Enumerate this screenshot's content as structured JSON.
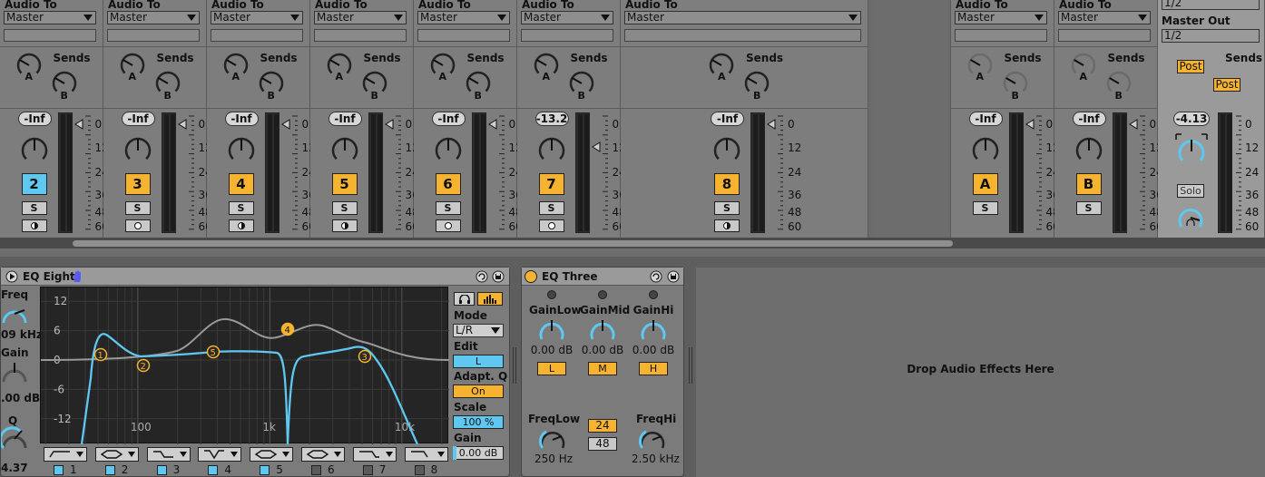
{
  "mixer": {
    "tracks": [
      {
        "audio_to_label": "Audio To",
        "output": "Master",
        "sends_label": "Sends",
        "send_a": "A",
        "send_b": "B",
        "volume": "-Inf",
        "number": "2",
        "number_color": "#5ec8f0",
        "solo": "S",
        "rec_style": "half"
      },
      {
        "audio_to_label": "Audio To",
        "output": "Master",
        "sends_label": "Sends",
        "send_a": "A",
        "send_b": "B",
        "volume": "-Inf",
        "number": "3",
        "number_color": "#f5b330",
        "solo": "S",
        "rec_style": "ring"
      },
      {
        "audio_to_label": "Audio To",
        "output": "Master",
        "sends_label": "Sends",
        "send_a": "A",
        "send_b": "B",
        "volume": "-Inf",
        "number": "4",
        "number_color": "#f5b330",
        "solo": "S",
        "rec_style": "half"
      },
      {
        "audio_to_label": "Audio To",
        "output": "Master",
        "sends_label": "Sends",
        "send_a": "A",
        "send_b": "B",
        "volume": "-Inf",
        "number": "5",
        "number_color": "#f5b330",
        "solo": "S",
        "rec_style": "half"
      },
      {
        "audio_to_label": "Audio To",
        "output": "Master",
        "sends_label": "Sends",
        "send_a": "A",
        "send_b": "B",
        "volume": "-Inf",
        "number": "6",
        "number_color": "#f5b330",
        "solo": "S",
        "rec_style": "ring"
      },
      {
        "audio_to_label": "Audio To",
        "output": "Master",
        "sends_label": "Sends",
        "send_a": "A",
        "send_b": "B",
        "volume": "-13.2",
        "number": "7",
        "number_color": "#f5b330",
        "solo": "S",
        "rec_style": "ring"
      },
      {
        "audio_to_label": "Audio To",
        "output": "Master",
        "sends_label": "Sends",
        "send_a": "A",
        "send_b": "B",
        "volume": "-Inf",
        "number": "8",
        "number_color": "#f5b330",
        "solo": "S",
        "rec_style": "half"
      }
    ],
    "returns": [
      {
        "audio_to_label": "Audio To",
        "output": "Master",
        "sends_label": "Sends",
        "send_a": "A",
        "send_b": "B",
        "volume": "-Inf",
        "number": "A",
        "number_color": "#f5b330",
        "solo": "S"
      },
      {
        "audio_to_label": "Audio To",
        "output": "Master",
        "sends_label": "Sends",
        "send_a": "A",
        "send_b": "B",
        "volume": "-Inf",
        "number": "B",
        "number_color": "#f5b330",
        "solo": "S"
      }
    ],
    "master": {
      "top_value": "1/2",
      "out_label": "Master Out",
      "out_value": "1/2",
      "sends_label": "Sends",
      "post_a": "Post",
      "post_b": "Post",
      "volume": "-4.13",
      "solo": "Solo"
    },
    "meter_scale": [
      "0",
      "12",
      "24",
      "36",
      "48",
      "60"
    ]
  },
  "eq_eight": {
    "title": "EQ Eight",
    "freq_label": "Freq",
    "freq_value": "09 kHz",
    "gain_label": "Gain",
    "gain_value": ".00 dB",
    "q_label": "Q",
    "q_value": "4.37",
    "y_ticks": [
      "12",
      "6",
      "0",
      "-6",
      "-12"
    ],
    "x_ticks": [
      "100",
      "1k",
      "10k"
    ],
    "band_markers": [
      "1",
      "2",
      "5",
      "4",
      "3"
    ],
    "bands": [
      {
        "num": "1",
        "on": true
      },
      {
        "num": "2",
        "on": true
      },
      {
        "num": "3",
        "on": true
      },
      {
        "num": "4",
        "on": true
      },
      {
        "num": "5",
        "on": true
      },
      {
        "num": "6",
        "on": false
      },
      {
        "num": "7",
        "on": false
      },
      {
        "num": "8",
        "on": false
      }
    ],
    "mode_label": "Mode",
    "mode_value": "L/R",
    "edit_label": "Edit",
    "edit_value": "L",
    "adaptq_label": "Adapt. Q",
    "adaptq_value": "On",
    "scale_label": "Scale",
    "scale_value": "100 %",
    "gain2_label": "Gain",
    "gain2_value": "0.00 dB"
  },
  "eq_three": {
    "title": "EQ Three",
    "gainlow_label": "GainLow",
    "gainlow_value": "0.00 dB",
    "low_btn": "L",
    "gainmid_label": "GainMid",
    "gainmid_value": "0.00 dB",
    "mid_btn": "M",
    "gainhi_label": "GainHi",
    "gainhi_value": "0.00 dB",
    "hi_btn": "H",
    "freqlow_label": "FreqLow",
    "freqlow_value": "250 Hz",
    "slope_24": "24",
    "slope_48": "48",
    "freqhi_label": "FreqHi",
    "freqhi_value": "2.50 kHz"
  },
  "drop_zone": {
    "text": "Drop Audio Effects Here"
  }
}
